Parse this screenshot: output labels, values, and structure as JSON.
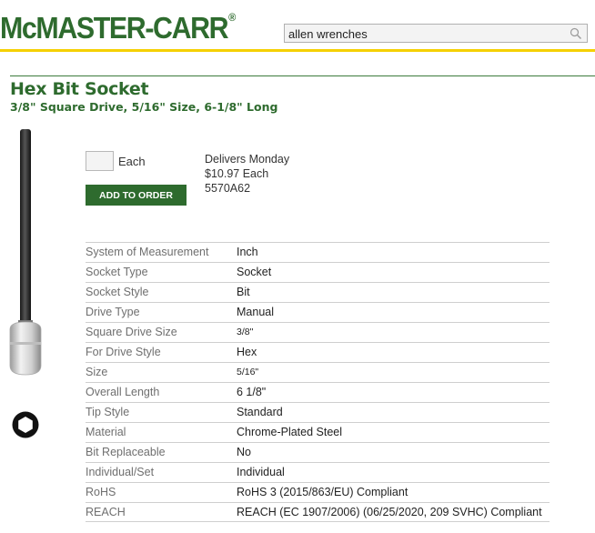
{
  "header": {
    "logo_text": "McMASTER-CARR",
    "logo_mark": "®",
    "search_value": "allen wrenches"
  },
  "product": {
    "title": "Hex Bit Socket",
    "subtitle": "3/8\" Square Drive, 5/16\" Size, 6-1/8\" Long"
  },
  "order": {
    "quantity": "",
    "unit": "Each",
    "button_label": "ADD TO ORDER",
    "delivery": "Delivers Monday",
    "price": "$10.97 Each",
    "part_number": "5570A62"
  },
  "specs": [
    {
      "label": "System of Measurement",
      "value": "Inch"
    },
    {
      "label": "Socket Type",
      "value": "Socket"
    },
    {
      "label": "Socket Style",
      "value": "Bit"
    },
    {
      "label": "Drive Type",
      "value": "Manual"
    },
    {
      "label": "Square Drive Size",
      "value": "3/8\""
    },
    {
      "label": "For Drive Style",
      "value": "Hex"
    },
    {
      "label": "Size",
      "value": "5/16\""
    },
    {
      "label": "Overall Length",
      "value": "6 1/8\""
    },
    {
      "label": "Tip Style",
      "value": "Standard"
    },
    {
      "label": "Material",
      "value": "Chrome-Plated Steel"
    },
    {
      "label": "Bit Replaceable",
      "value": "No"
    },
    {
      "label": "Individual/Set",
      "value": "Individual"
    },
    {
      "label": "RoHS",
      "value": "RoHS 3 (2015/863/EU) Compliant"
    },
    {
      "label": "REACH",
      "value": "REACH (EC 1907/2006) (06/25/2020, 209 SVHC) Compliant"
    }
  ],
  "colors": {
    "brand_green": "#2e6b2e",
    "accent_yellow": "#f5d000"
  },
  "icons": [
    "search-icon",
    "hex-shape-icon"
  ]
}
